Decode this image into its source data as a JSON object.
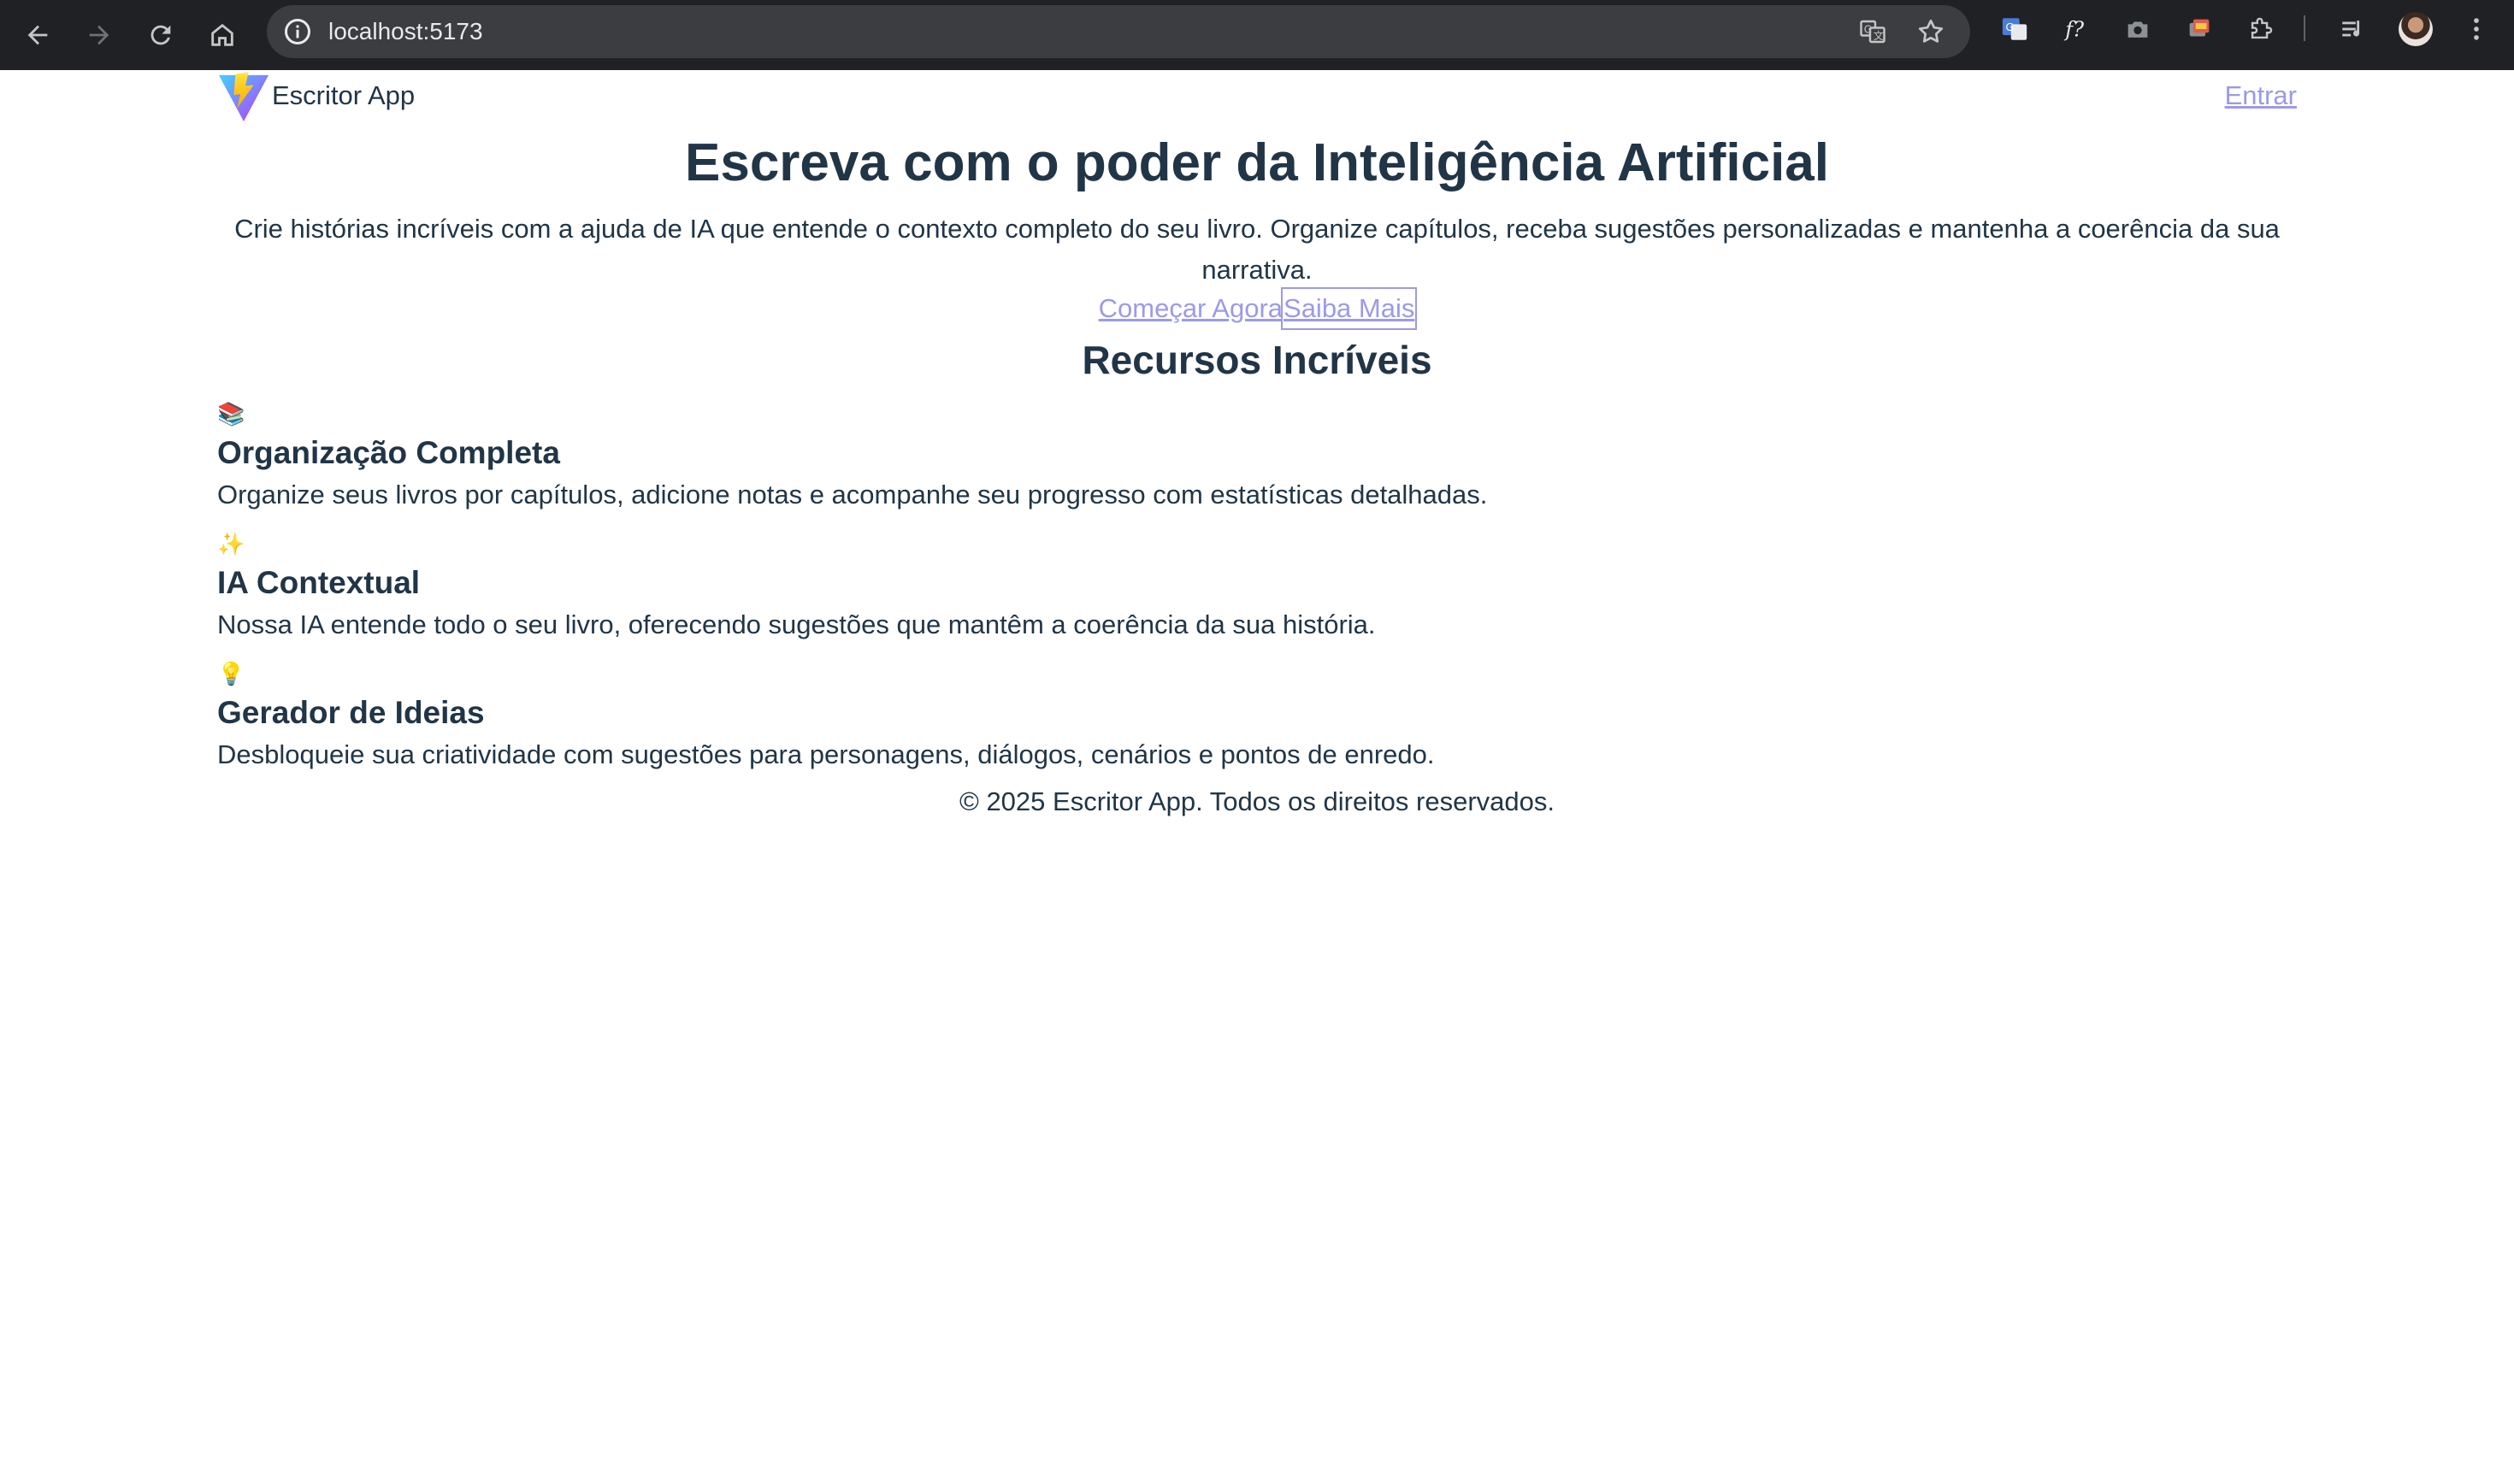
{
  "browser": {
    "url": "localhost:5173",
    "nav_icons": [
      "back-arrow-icon",
      "forward-arrow-icon",
      "reload-icon",
      "home-icon"
    ],
    "omnibox_icons": [
      "site-info-icon",
      "translate-icon",
      "bookmark-star-icon"
    ],
    "extension_icons": [
      "google-translate-icon",
      "font-inspector-icon",
      "screenshot-camera-icon",
      "color-picker-icon",
      "extensions-puzzle-icon",
      "reading-list-icon",
      "profile-avatar",
      "menu-kebab-icon"
    ]
  },
  "header": {
    "logo_icon": "vite-logo-icon",
    "app_name": "Escritor App",
    "login_label": "Entrar"
  },
  "hero": {
    "title": "Escreva com o poder da Inteligência Artificial",
    "subtitle": "Crie histórias incríveis com a ajuda de IA que entende o contexto completo do seu livro. Organize capítulos, receba sugestões personalizadas e mantenha a coerência da sua narrativa.",
    "primary_cta": "Começar Agora",
    "secondary_cta": "Saiba Mais"
  },
  "features": {
    "title": "Recursos Incríveis",
    "items": [
      {
        "icon": "📚",
        "title": "Organização Completa",
        "description": "Organize seus livros por capítulos, adicione notas e acompanhe seu progresso com estatísticas detalhadas."
      },
      {
        "icon": "✨",
        "title": "IA Contextual",
        "description": "Nossa IA entende todo o seu livro, oferecendo sugestões que mantêm a coerência da sua história."
      },
      {
        "icon": "💡",
        "title": "Gerador de Ideias",
        "description": "Desbloqueie sua criatividade com sugestões para personagens, diálogos, cenários e pontos de enredo."
      }
    ]
  },
  "footer": {
    "copyright": "© 2025 Escritor App. Todos os direitos reservados."
  },
  "colors": {
    "text": "#213547",
    "link": "#9b9ae8",
    "chrome_bg": "#202124",
    "omnibox_bg": "#3c3d40"
  }
}
